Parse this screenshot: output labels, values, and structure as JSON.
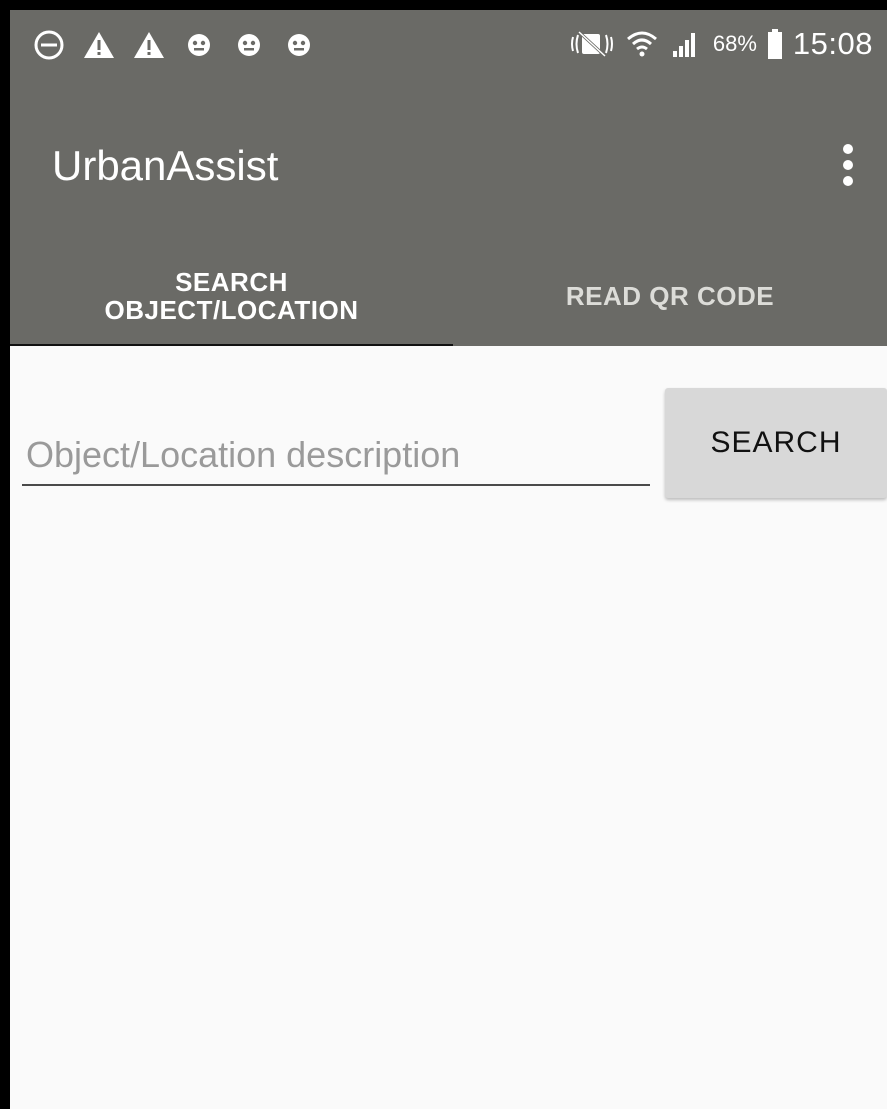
{
  "status_bar": {
    "left_icons": [
      "minus-circle-icon",
      "warning-icon",
      "warning-icon",
      "notification-icon",
      "notification-icon",
      "notification-icon"
    ],
    "right_icons": [
      "vibrate-icon",
      "wifi-icon",
      "signal-icon",
      "battery-icon"
    ],
    "battery_percent": "68%",
    "time": "15:08"
  },
  "app_bar": {
    "title": "UrbanAssist",
    "overflow_icon": "more-vert-icon"
  },
  "tabs": [
    {
      "label": "SEARCH\nOBJECT/LOCATION",
      "active": true
    },
    {
      "label": "READ QR CODE",
      "active": false
    }
  ],
  "search": {
    "placeholder": "Object/Location description",
    "value": "",
    "button_label": "SEARCH"
  },
  "colors": {
    "toolbar": "#6a6a66",
    "background": "#fafafa",
    "button": "#d8d8d8",
    "tab_indicator": "#111111"
  }
}
